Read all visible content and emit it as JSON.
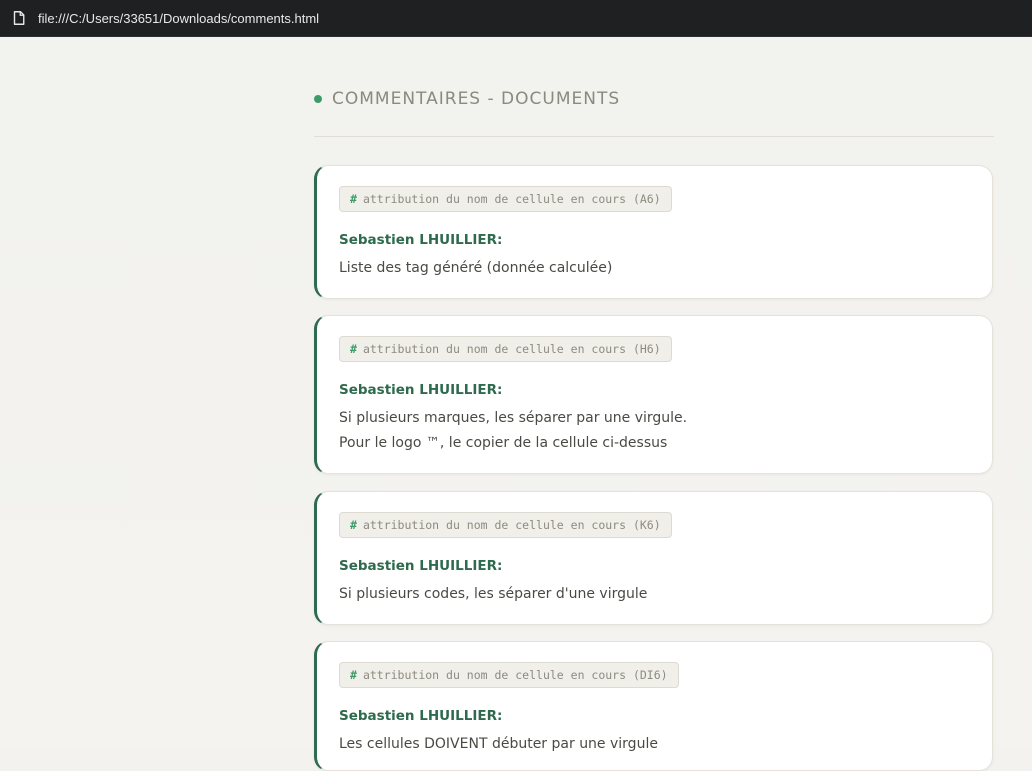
{
  "browser": {
    "url": "file:///C:/Users/33651/Downloads/comments.html"
  },
  "header": {
    "title": "COMMENTAIRES - DOCUMENTS"
  },
  "colors": {
    "accent": "#2f6b4f",
    "dot": "#3f9a6a"
  },
  "icons": {
    "address_bar": "file-icon",
    "header_bullet": "dot-icon",
    "tag_prefix": "hash-icon"
  },
  "comments": [
    {
      "tag": "attribution du nom de cellule en cours (A6)",
      "author": "Sebastien LHUILLIER:",
      "lines": [
        "Liste des tag généré (donnée calculée)"
      ]
    },
    {
      "tag": "attribution du nom de cellule en cours (H6)",
      "author": "Sebastien LHUILLIER:",
      "lines": [
        "Si plusieurs marques, les séparer par une virgule.",
        "Pour le logo ™, le copier de la cellule ci-dessus"
      ]
    },
    {
      "tag": "attribution du nom de cellule en cours (K6)",
      "author": "Sebastien LHUILLIER:",
      "lines": [
        "Si plusieurs codes, les séparer d'une virgule"
      ]
    },
    {
      "tag": "attribution du nom de cellule en cours (DI6)",
      "author": "Sebastien LHUILLIER:",
      "lines": [
        "Les cellules DOIVENT débuter par une virgule"
      ]
    }
  ]
}
